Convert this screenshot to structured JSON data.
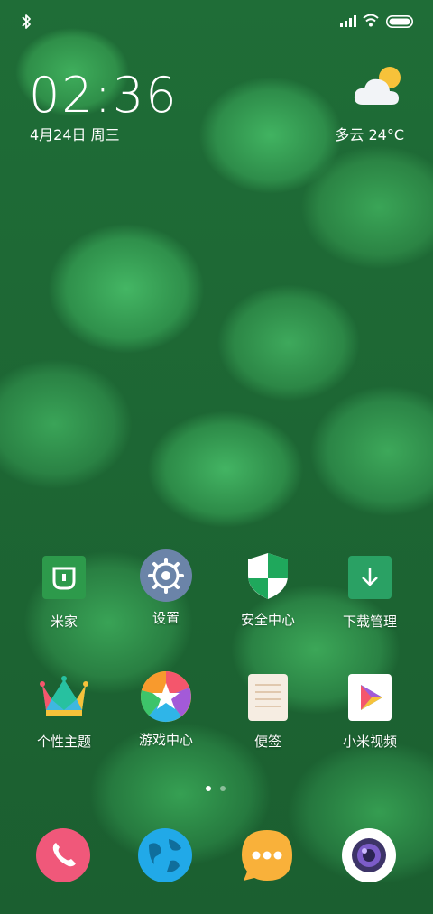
{
  "status_bar": {
    "icons": [
      "bluetooth-icon",
      "signal-icon",
      "wifi-icon",
      "battery-icon"
    ]
  },
  "clock_widget": {
    "time": "02:36",
    "date": "4月24日 周三"
  },
  "weather_widget": {
    "icon": "partly-cloudy-icon",
    "text": "多云  24°C"
  },
  "apps_row1": [
    {
      "label": "米家",
      "icon": "mijia-icon"
    },
    {
      "label": "设置",
      "icon": "settings-gear-icon"
    },
    {
      "label": "安全中心",
      "icon": "security-shield-icon"
    },
    {
      "label": "下载管理",
      "icon": "download-icon"
    }
  ],
  "apps_row2": [
    {
      "label": "个性主题",
      "icon": "themes-crown-icon"
    },
    {
      "label": "游戏中心",
      "icon": "game-star-icon"
    },
    {
      "label": "便签",
      "icon": "notes-icon"
    },
    {
      "label": "小米视频",
      "icon": "video-play-icon"
    }
  ],
  "page_indicator": {
    "pages": 2,
    "current": 1
  },
  "dock": [
    "phone-icon",
    "browser-globe-icon",
    "messages-icon",
    "camera-icon"
  ],
  "colors": {
    "mijia_green": "#2d9a4b",
    "settings_bg": "#6b84a8",
    "shield_green": "#1fa85c",
    "download_green": "#2aa164",
    "phone_pink": "#f0587a",
    "globe_blue": "#21a9e8",
    "message_orange": "#f9b13a"
  }
}
